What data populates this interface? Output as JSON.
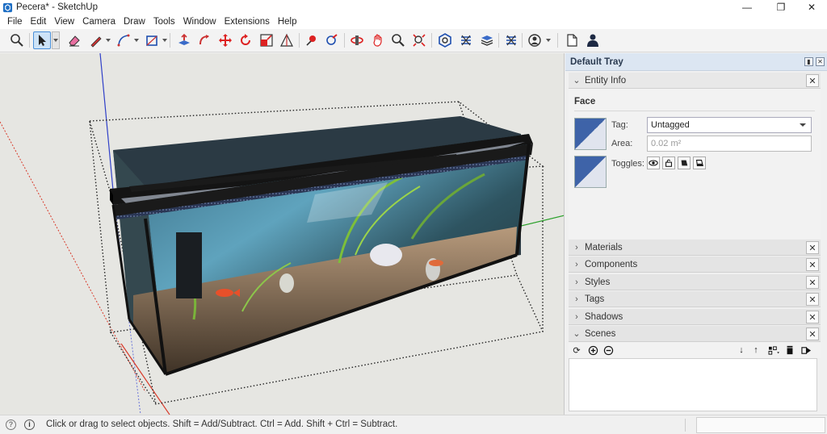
{
  "window": {
    "title": "Pecera* - SketchUp",
    "controls": {
      "minimize": "—",
      "maximize": "❐",
      "close": "✕"
    }
  },
  "menu": [
    "File",
    "Edit",
    "View",
    "Camera",
    "Draw",
    "Tools",
    "Window",
    "Extensions",
    "Help"
  ],
  "toolbar": {
    "tools": [
      "search-icon",
      "select-icon",
      "eraser-icon",
      "line-icon",
      "arc-icon",
      "rectangle-icon",
      "push-pull-icon",
      "follow-me-icon",
      "move-icon",
      "rotate-icon",
      "scale-icon",
      "tape-measure-icon",
      "section-plane-icon",
      "paint-bucket-icon",
      "orbit-icon",
      "pan-icon",
      "zoom-icon",
      "zoom-extents-icon",
      "warehouse-icon",
      "extension-warehouse-icon",
      "layout-icon",
      "sandbox-icon",
      "account-icon",
      "new-file-icon",
      "profile-icon"
    ]
  },
  "tray": {
    "title": "Default Tray",
    "entity_info": {
      "header": "Entity Info",
      "type": "Face",
      "tag_label": "Tag:",
      "tag_value": "Untagged",
      "area_label": "Area:",
      "area_value": "0.02 m²",
      "toggles_label": "Toggles:",
      "toggles": [
        "eye-icon",
        "lock-icon",
        "cast-shadow-icon",
        "receive-shadow-icon"
      ]
    },
    "panels": [
      "Materials",
      "Components",
      "Styles",
      "Tags",
      "Shadows",
      "Scenes"
    ],
    "scenes_toolbar": [
      "refresh-icon",
      "add-icon",
      "remove-icon",
      "move-down-icon",
      "move-up-icon",
      "view-options-icon",
      "details-icon",
      "scene-arrow-icon"
    ]
  },
  "status": {
    "message": "Click or drag to select objects. Shift = Add/Subtract. Ctrl = Add. Shift + Ctrl = Subtract.",
    "measurements_value": ""
  },
  "colors": {
    "axis_blue": "#2f3fc8",
    "axis_red": "#d83a2a",
    "axis_green": "#2aa02a",
    "tray_header": "#dce6f2",
    "selection_blue": "#4a90d9"
  }
}
